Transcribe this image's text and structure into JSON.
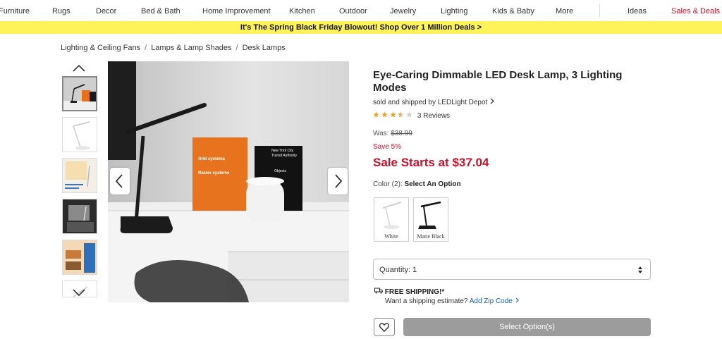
{
  "nav": {
    "items": [
      "Furniture",
      "Rugs",
      "Decor",
      "Bed & Bath",
      "Home Improvement",
      "Kitchen",
      "Outdoor",
      "Jewelry",
      "Lighting",
      "Kids & Baby",
      "More",
      "Ideas",
      "Sales & Deals"
    ]
  },
  "banner": {
    "text": "It's The Spring Black Friday Blowout! Shop Over 1 Million Deals >"
  },
  "breadcrumb": [
    "Lighting & Ceiling Fans",
    "Lamps & Lamp Shades",
    "Desk Lamps"
  ],
  "breadcrumb_sep": "/",
  "product": {
    "title": "Eye-Caring Dimmable LED Desk Lamp, 3 Lighting Modes",
    "seller_prefix": "sold and shipped by ",
    "seller": "LEDLight Depot",
    "rating": 3.5,
    "reviews": "3 Reviews",
    "was_label": "Was: ",
    "was_price": "$38.99",
    "save": "Save 5%",
    "sale": "Sale Starts at $37.04",
    "color_label": "Color (2): ",
    "color_prompt": "Select An Option",
    "colors": [
      "White",
      "Matte Black"
    ],
    "quantity": "Quantity: 1",
    "shipping": "FREE SHIPPING!*",
    "ship_question": "Want a shipping estimate?",
    "zip_link": "Add Zip Code",
    "select_button": "Select Option(s)"
  },
  "image_text": {
    "book1_line1": "Grid systems",
    "book1_line2": "Raster systeme",
    "book2_line1": "New York City",
    "book2_line2": "Transit Authority",
    "book2_line3": "Objects"
  },
  "colors": {
    "accent_red": "#c8102e",
    "banner_yellow": "#fff35a",
    "link_blue": "#1a5fa8",
    "button_gray": "#9c9c9c"
  }
}
